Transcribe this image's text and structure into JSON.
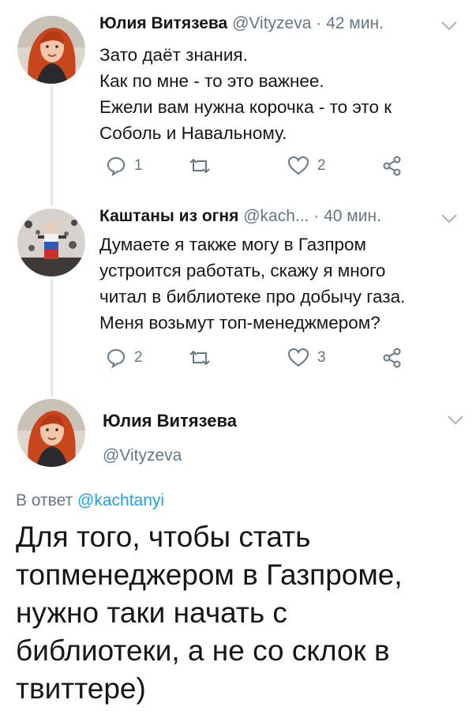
{
  "tweets": [
    {
      "author_name": "Юлия Витязева",
      "handle": "@Vityzeva",
      "time": "· 42 мин.",
      "text_lines": [
        "Зато даёт знания.",
        "Как по мне - то это важнее.",
        "Ежели вам нужна корочка - то это к",
        "Соболь и Навальному."
      ],
      "reply_count": "1",
      "retweet_count": "",
      "like_count": "2"
    },
    {
      "author_name": "Каштаны из огня",
      "handle": "@kach...",
      "time": "· 40 мин.",
      "text_lines": [
        "Думаете я также могу в Газпром",
        "устроится работать, скажу я много",
        "читал в библиотеке про добычу газа.",
        "Меня возьмут топ-менеджмером?"
      ],
      "reply_count": "2",
      "retweet_count": "",
      "like_count": "3"
    }
  ],
  "main_tweet": {
    "author_name": "Юлия Витязева",
    "handle": "@Vityzeva",
    "reply_prefix": "В ответ",
    "reply_mention": "@kachtanyi",
    "text_lines": [
      "Для того, чтобы стать",
      "топменеджером в Газпроме,",
      "нужно таки начать с",
      "библиотеки, а не со склок в",
      "твиттере)"
    ]
  },
  "colors": {
    "secondary_text": "#657786",
    "link": "#1da1f2",
    "thread_line": "#e1e8ed",
    "avatar_hair": "#c8461e"
  }
}
